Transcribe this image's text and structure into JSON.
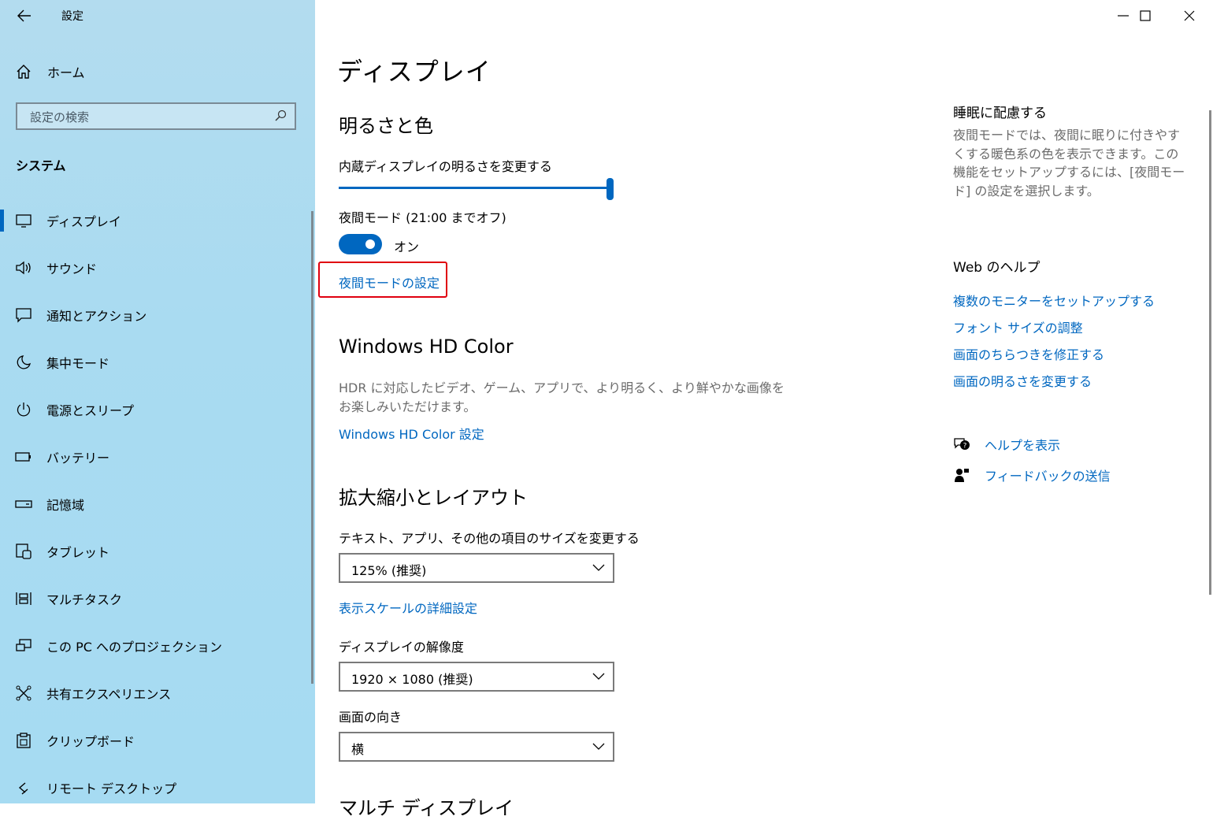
{
  "app": {
    "title": "設定"
  },
  "sidebar": {
    "home_label": "ホーム",
    "search_placeholder": "設定の検索",
    "section": "システム",
    "items": [
      {
        "label": "ディスプレイ",
        "icon": "monitor-icon",
        "active": true
      },
      {
        "label": "サウンド",
        "icon": "speaker-icon"
      },
      {
        "label": "通知とアクション",
        "icon": "notification-icon"
      },
      {
        "label": "集中モード",
        "icon": "moon-icon"
      },
      {
        "label": "電源とスリープ",
        "icon": "power-icon"
      },
      {
        "label": "バッテリー",
        "icon": "battery-icon"
      },
      {
        "label": "記憶域",
        "icon": "storage-icon"
      },
      {
        "label": "タブレット",
        "icon": "tablet-icon"
      },
      {
        "label": "マルチタスク",
        "icon": "multitask-icon"
      },
      {
        "label": "この PC へのプロジェクション",
        "icon": "projection-icon"
      },
      {
        "label": "共有エクスペリエンス",
        "icon": "share-icon"
      },
      {
        "label": "クリップボード",
        "icon": "clipboard-icon"
      },
      {
        "label": "リモート デスクトップ",
        "icon": "remote-desktop-icon"
      }
    ]
  },
  "main": {
    "title": "ディスプレイ",
    "brightness": {
      "heading": "明るさと色",
      "slider_label": "内蔵ディスプレイの明るさを変更する",
      "brightness_fraction": 1.0,
      "night_mode_label": "夜間モード (21:00 までオフ)",
      "toggle_state": "オン",
      "night_mode_link": "夜間モードの設定"
    },
    "hdr": {
      "heading": "Windows HD Color",
      "description": "HDR に対応したビデオ、ゲーム、アプリで、より明るく、より鮮やかな画像をお楽しみいただけます。",
      "link": "Windows HD Color 設定"
    },
    "scale": {
      "heading": "拡大縮小とレイアウト",
      "size_label": "テキスト、アプリ、その他の項目のサイズを変更する",
      "size_value": "125% (推奨)",
      "advanced_link": "表示スケールの詳細設定",
      "resolution_label": "ディスプレイの解像度",
      "resolution_value": "1920 × 1080 (推奨)",
      "orientation_label": "画面の向き",
      "orientation_value": "横",
      "next_heading": "マルチ ディスプレイ"
    }
  },
  "right": {
    "sleep_heading": "睡眠に配慮する",
    "sleep_desc": "夜間モードでは、夜間に眠りに付きやすくする暖色系の色を表示できます。この機能をセットアップするには、[夜間モード] の設定を選択します。",
    "web_heading": "Web のヘルプ",
    "web_links": [
      "複数のモニターをセットアップする",
      "フォント サイズの調整",
      "画面のちらつきを修正する",
      "画面の明るさを変更する"
    ],
    "help_label": "ヘルプを表示",
    "feedback_label": "フィードバックの送信"
  },
  "colors": {
    "accent": "#0067c0",
    "highlight": "#e0000f",
    "sidebar_bg": "#a9dbf1"
  }
}
